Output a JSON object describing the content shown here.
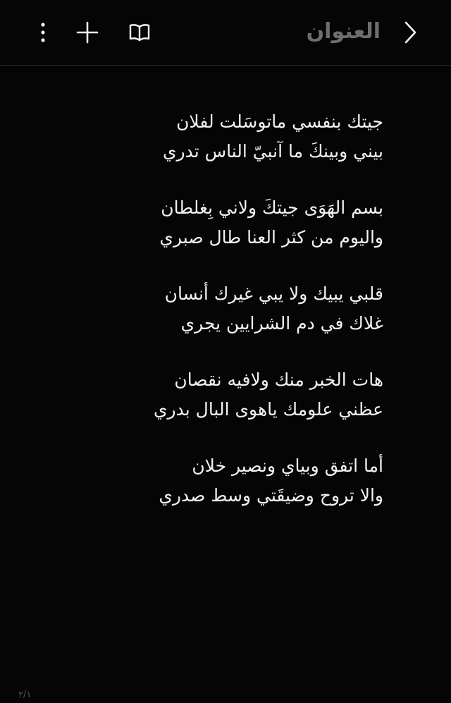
{
  "header": {
    "title": "العنوان",
    "icons": {
      "more": "more-vertical-icon",
      "add": "plus-icon",
      "reader": "book-open-icon",
      "back": "chevron-right-icon"
    }
  },
  "note": {
    "stanzas": [
      [
        "جيتك بنفسي ماتوسَلت لفلان",
        "بيني وبينكَ ما آنبيّ الناس تدري"
      ],
      [
        "بسم الهَوَى جيتكَ ولاني بِغلطان",
        "واليوم من كثر العنا طال صبري"
      ],
      [
        "قلبي يبيك ولا يبي غيرك أنسان",
        "غلاك في دم الشرايين يجري"
      ],
      [
        "هات الخبر منك ولافيه نقصان",
        "عظني علومك ياهوى البال بدري"
      ],
      [
        "أما اتفق وبياي ونصير  خلان",
        "والا تروح وضيقَتي وسط صدري"
      ]
    ]
  },
  "footer": {
    "page_indicator": "٢/١"
  },
  "colors": {
    "background": "#050505",
    "text": "#f2f2f2",
    "title": "#6e6e6e",
    "divider": "#2a2a2a"
  }
}
